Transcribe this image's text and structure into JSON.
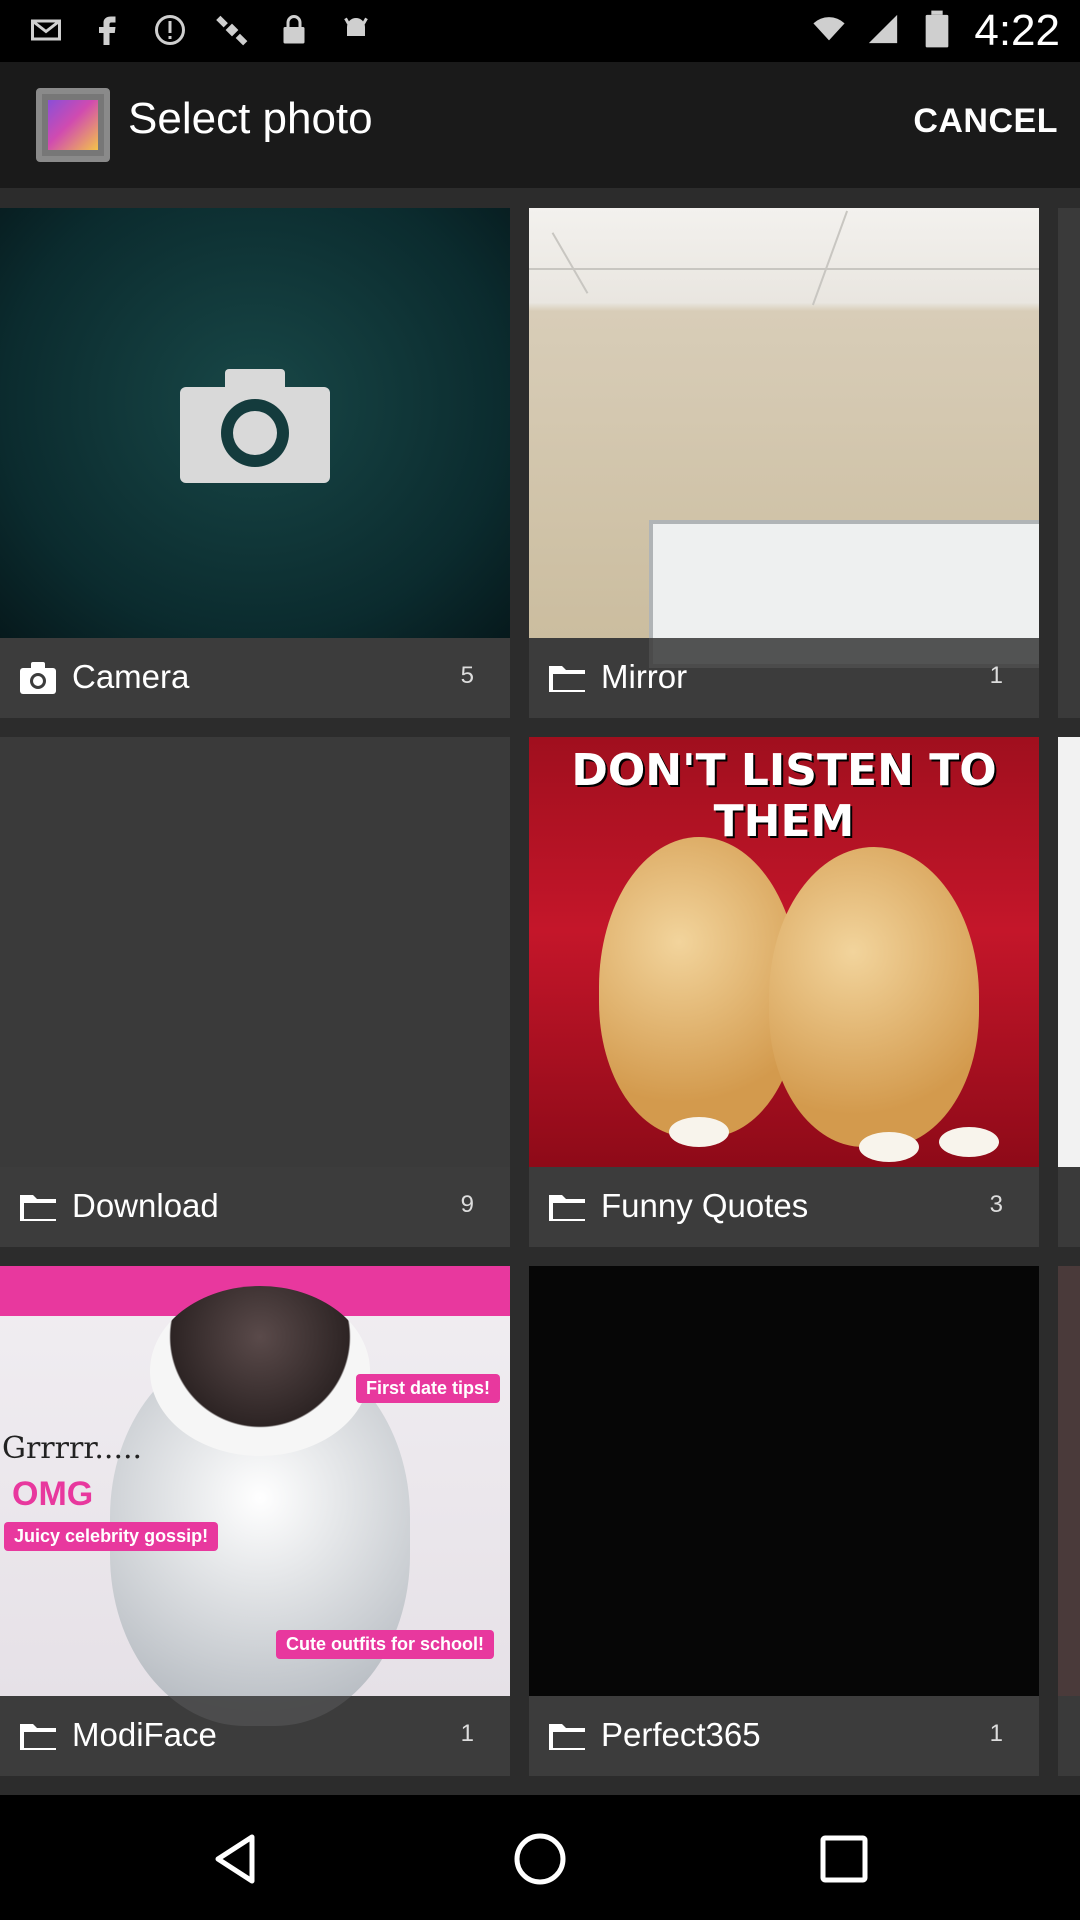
{
  "status_bar": {
    "time": "4:22",
    "icons": [
      "mail-icon",
      "facebook-icon",
      "alert-icon",
      "satellite-icon",
      "lock-icon",
      "android-icon"
    ]
  },
  "header": {
    "title": "Select photo",
    "cancel_label": "CANCEL"
  },
  "albums": [
    {
      "name": "Camera",
      "count": "5",
      "icon": "camera-icon"
    },
    {
      "name": "Mirror",
      "count": "1",
      "icon": "folder-icon"
    },
    {
      "name": "Download",
      "count": "9",
      "icon": "folder-icon"
    },
    {
      "name": "Funny Quotes",
      "count": "3",
      "icon": "folder-icon",
      "thumb_caption": "DON'T LISTEN TO THEM"
    },
    {
      "name": "ModiFace",
      "count": "1",
      "icon": "folder-icon",
      "thumb_texts": [
        "Grrrrr.....",
        "OMG",
        "First date tips!",
        "Juicy celebrity gossip!",
        "Cute outfits for school!"
      ]
    },
    {
      "name": "Perfect365",
      "count": "1",
      "icon": "folder-icon"
    }
  ],
  "colors": {
    "background": "#000000",
    "app_bar": "#1a1a1a",
    "grid_background": "#2c2c2c",
    "caption_bar": "#3c3c3c"
  }
}
